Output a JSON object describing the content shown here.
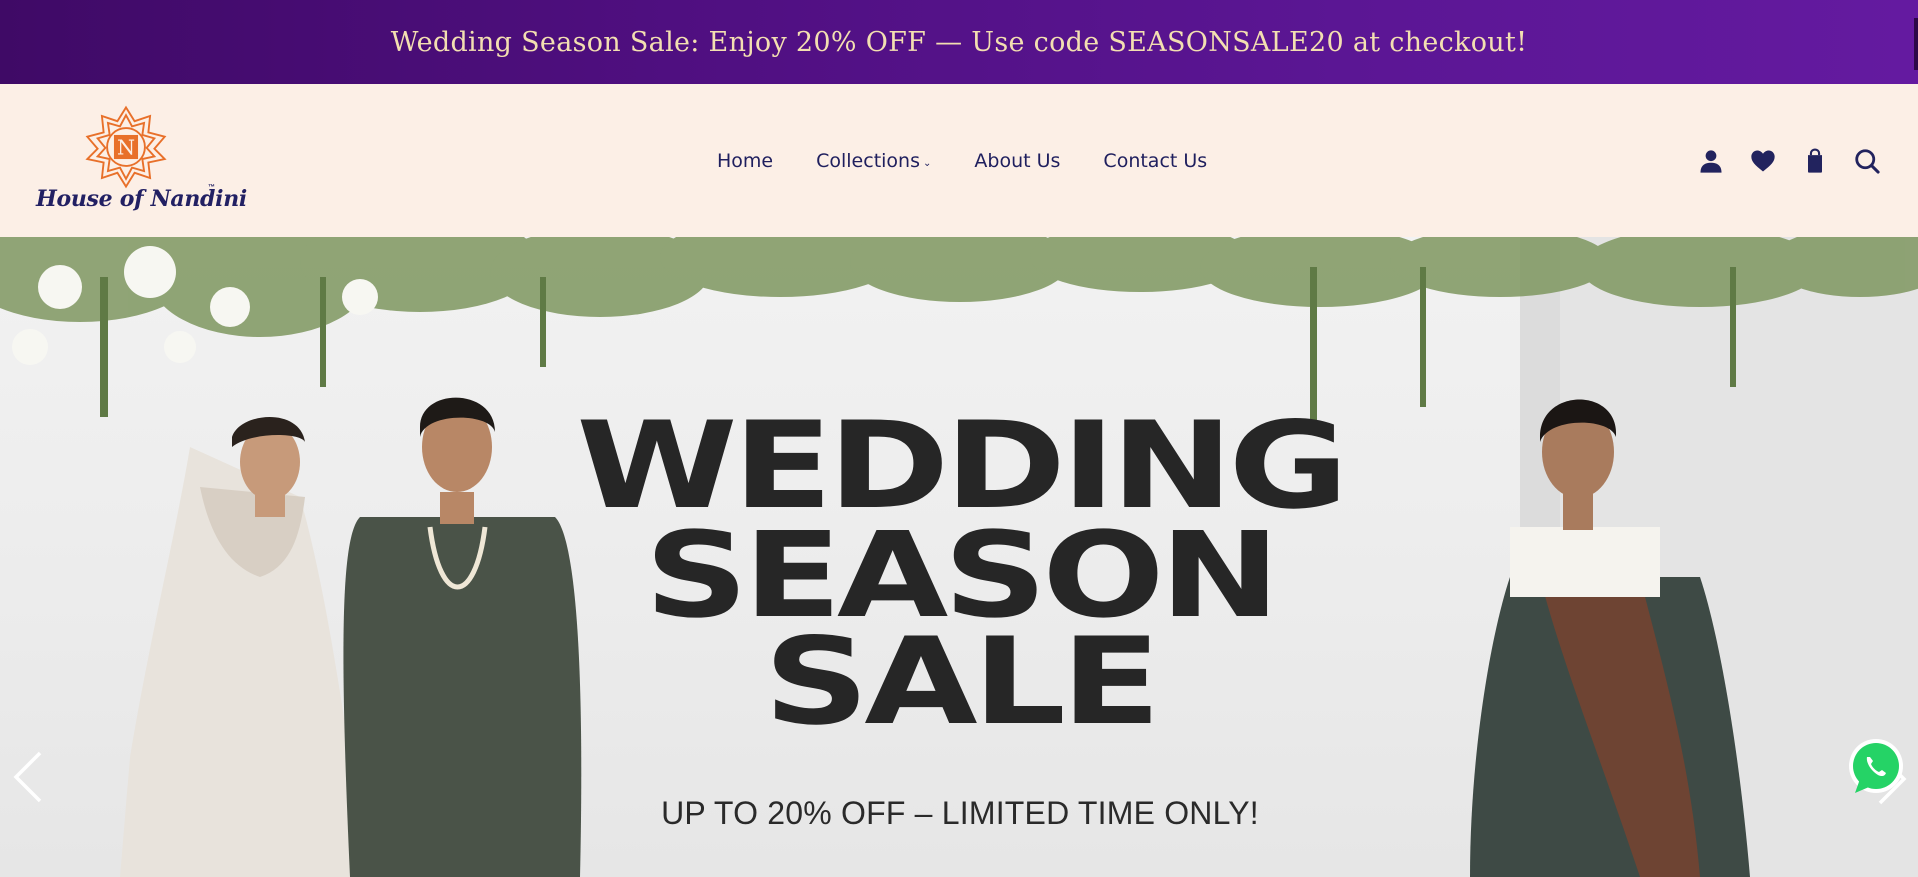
{
  "announcement": {
    "text": "Wedding Season Sale: Enjoy 20% OFF — Use code SEASONSALE20 at checkout!"
  },
  "brand": {
    "name": "House of Nandini",
    "tm": "™",
    "monogram": "N",
    "accent_color": "#e8702a",
    "text_color": "#222063"
  },
  "nav": {
    "items": [
      {
        "label": "Home"
      },
      {
        "label": "Collections",
        "has_dropdown": true
      },
      {
        "label": "About Us"
      },
      {
        "label": "Contact Us"
      }
    ]
  },
  "header_icons": [
    "account-icon",
    "wishlist-heart-icon",
    "cart-bag-icon",
    "search-icon"
  ],
  "hero": {
    "title_lines": [
      "WEDDING",
      "SEASON",
      "SALE"
    ],
    "subtitle": "UP TO 20% OFF – LIMITED TIME ONLY!",
    "prev_icon": "chevron-left-icon",
    "next_icon": "chevron-right-icon"
  },
  "floating": {
    "whatsapp_icon": "whatsapp-icon",
    "whatsapp_color": "#25d366"
  },
  "colors": {
    "announcement_bg": "#4f0f80",
    "announcement_text": "#f3dfb1",
    "header_bg": "#fcefe6",
    "nav_text": "#1f1f5e"
  }
}
